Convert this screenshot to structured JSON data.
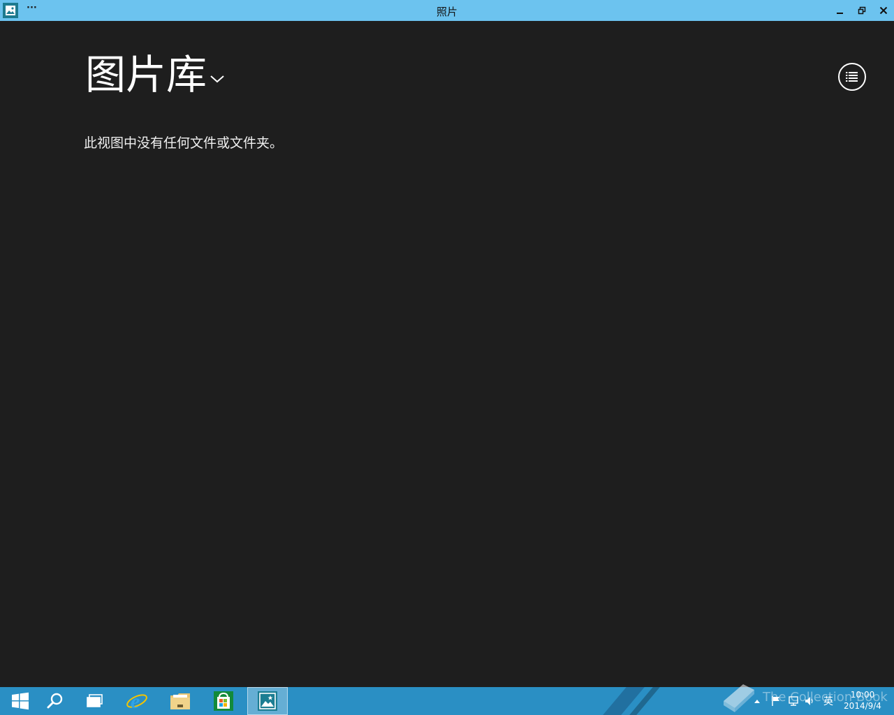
{
  "window": {
    "title": "照片",
    "more_label": "···",
    "icons": {
      "app": "photos-app-icon",
      "minimize": "minimize-icon",
      "maximize": "restore-icon",
      "close": "close-icon"
    }
  },
  "main": {
    "library_title": "图片库",
    "empty_message": "此视图中没有任何文件或文件夹。",
    "view_button_icon": "list-view-icon"
  },
  "taskbar": {
    "items": [
      {
        "name": "start",
        "icon": "windows-logo-icon"
      },
      {
        "name": "search",
        "icon": "search-icon"
      },
      {
        "name": "task-view",
        "icon": "task-view-icon"
      },
      {
        "name": "internet-explorer",
        "icon": "ie-icon"
      },
      {
        "name": "file-explorer",
        "icon": "folder-icon"
      },
      {
        "name": "store",
        "icon": "store-icon"
      },
      {
        "name": "photos",
        "icon": "photos-icon",
        "active": true
      }
    ],
    "tray": {
      "ime": "英",
      "time": "10:00",
      "date": "2014/9/4"
    },
    "watermark": "The Collection Book"
  },
  "colors": {
    "titlebar": "#6cc3ef",
    "background": "#1e1e1e",
    "taskbar": "#2a8fc4",
    "text": "#ffffff"
  }
}
